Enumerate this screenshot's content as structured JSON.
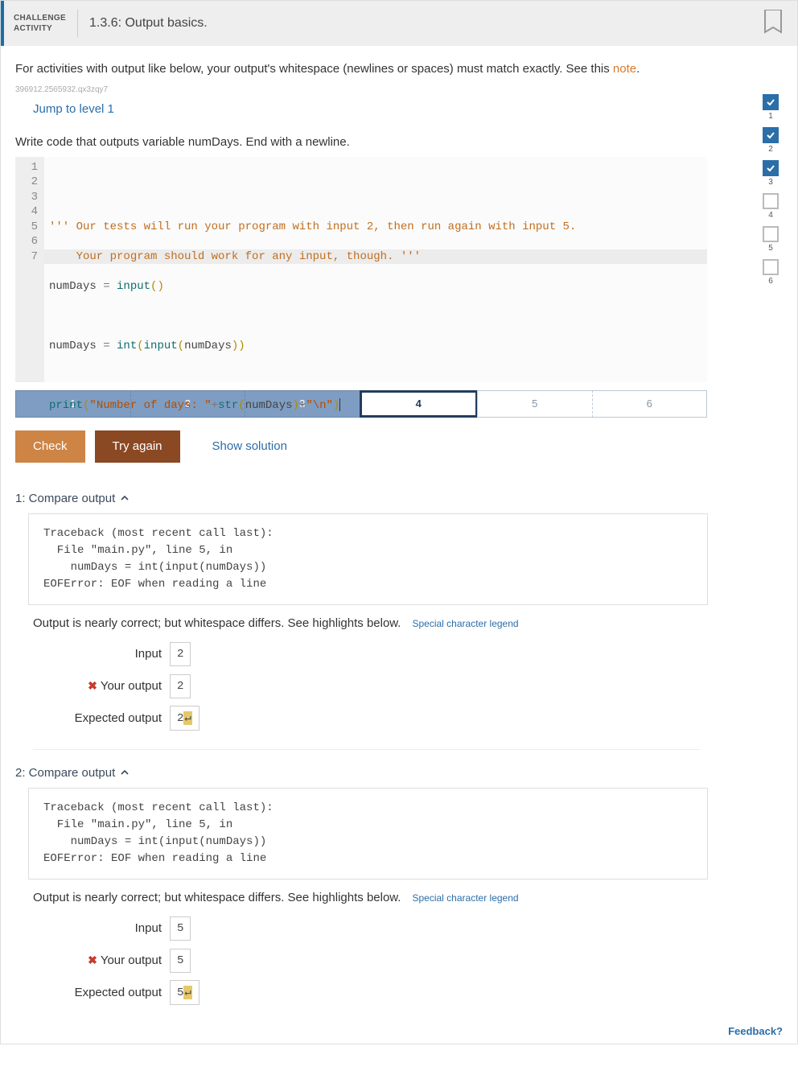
{
  "header": {
    "challenge_label": "CHALLENGE ACTIVITY",
    "title": "1.3.6: Output basics."
  },
  "intro": {
    "text_before_link": "For activities with output like below, your output's whitespace (newlines or spaces) must match exactly. See this ",
    "note_link": "note",
    "text_after_link": "."
  },
  "hash": "396912.2565932.qx3zqy7",
  "jump_link": "Jump to level 1",
  "prompt": "Write code that outputs variable numDays. End with a newline.",
  "level_sidebar": [
    {
      "n": "1",
      "done": true
    },
    {
      "n": "2",
      "done": true
    },
    {
      "n": "3",
      "done": true
    },
    {
      "n": "4",
      "done": false
    },
    {
      "n": "5",
      "done": false
    },
    {
      "n": "6",
      "done": false
    }
  ],
  "editor": {
    "line_numbers": [
      "1",
      "2",
      "3",
      "4",
      "5",
      "6",
      "7"
    ],
    "lines": {
      "l1": "''' Our tests will run your program with input 2, then run again with input 5.",
      "l2": "    Your program should work for any input, though. '''",
      "l3a": "numDays ",
      "l3b": "=",
      "l3c": " ",
      "l3d": "input",
      "l3e": "(",
      "l3f": ")",
      "l5a": "numDays ",
      "l5b": "=",
      "l5c": " ",
      "l5d": "int",
      "l5e": "(",
      "l5f": "input",
      "l5g": "(",
      "l5h": "numDays",
      "l5i": ")",
      "l5j": ")",
      "l7a": "print",
      "l7b": "(",
      "l7c": "\"Number of days: \"",
      "l7d": "+",
      "l7e": "str",
      "l7f": "(",
      "l7g": "numDays",
      "l7h": ")",
      "l7i": "+",
      "l7j": "\"\\n\"",
      "l7k": ")"
    }
  },
  "level_tabs": [
    {
      "label": "1",
      "state": "done"
    },
    {
      "label": "2",
      "state": "done"
    },
    {
      "label": "3",
      "state": "done"
    },
    {
      "label": "4",
      "state": "current"
    },
    {
      "label": "5",
      "state": "todo"
    },
    {
      "label": "6",
      "state": "todo"
    }
  ],
  "buttons": {
    "check": "Check",
    "try_again": "Try again",
    "show_solution": "Show solution"
  },
  "results": [
    {
      "title": "1: Compare output",
      "trace": "Traceback (most recent call last):\n  File \"main.py\", line 5, in \n    numDays = int(input(numDays))\nEOFError: EOF when reading a line",
      "note": "Output is nearly correct; but whitespace differs. See highlights below.",
      "legend": "Special character legend",
      "rows": {
        "input_label": "Input",
        "input_val": "2",
        "your_label": "Your output",
        "your_val": "2",
        "exp_label": "Expected output",
        "exp_val": "2",
        "exp_hl": "↵"
      }
    },
    {
      "title": "2: Compare output",
      "trace": "Traceback (most recent call last):\n  File \"main.py\", line 5, in \n    numDays = int(input(numDays))\nEOFError: EOF when reading a line",
      "note": "Output is nearly correct; but whitespace differs. See highlights below.",
      "legend": "Special character legend",
      "rows": {
        "input_label": "Input",
        "input_val": "5",
        "your_label": "Your output",
        "your_val": "5",
        "exp_label": "Expected output",
        "exp_val": "5",
        "exp_hl": "↵"
      }
    }
  ],
  "feedback": "Feedback?"
}
